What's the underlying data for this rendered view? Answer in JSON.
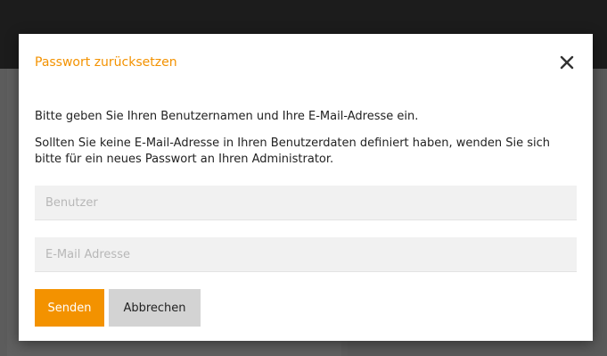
{
  "modal": {
    "title": "Passwort zurücksetzen",
    "text1": "Bitte geben Sie Ihren Benutzernamen und Ihre E-Mail-Adresse ein.",
    "text2": "Sollten Sie keine E-Mail-Adresse in Ihren Benutzerdaten definiert haben, wenden Sie sich bitte für ein neues Passwort an Ihren Administrator.",
    "user_field": {
      "value": "",
      "placeholder": "Benutzer"
    },
    "email_field": {
      "value": "",
      "placeholder": "E-Mail Adresse"
    },
    "send_label": "Senden",
    "cancel_label": "Abbrechen",
    "close_icon": "close-icon"
  },
  "colors": {
    "accent": "#f39200",
    "cancel_bg": "#d3d3d3",
    "field_bg": "#f1f1f1",
    "overlay": "#5e5e5e",
    "topbar": "#1c1c1c"
  }
}
